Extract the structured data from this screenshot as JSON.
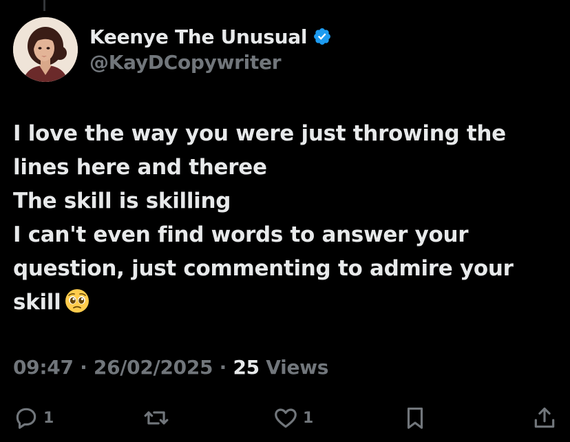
{
  "author": {
    "display_name": "Keenye The Unusual",
    "handle": "@KayDCopywriter",
    "verified": true,
    "avatar_icon": "profile-avatar"
  },
  "post": {
    "lines": [
      "I love the way you were just throwing the",
      "lines here and theree",
      "The skill is skilling",
      "I can't even find words to answer your",
      "question, just commenting to admire your",
      "skill"
    ],
    "emoji": "pleading-face-emoji"
  },
  "meta": {
    "time": "09:47",
    "separator": "·",
    "date": "26/02/2025",
    "views_count": "25",
    "views_label": "Views"
  },
  "actions": {
    "reply_count": "1",
    "like_count": "1"
  },
  "colors": {
    "background": "#000000",
    "text": "#e7e9ea",
    "secondary": "#71767b",
    "verified": "#1d9bf0"
  }
}
